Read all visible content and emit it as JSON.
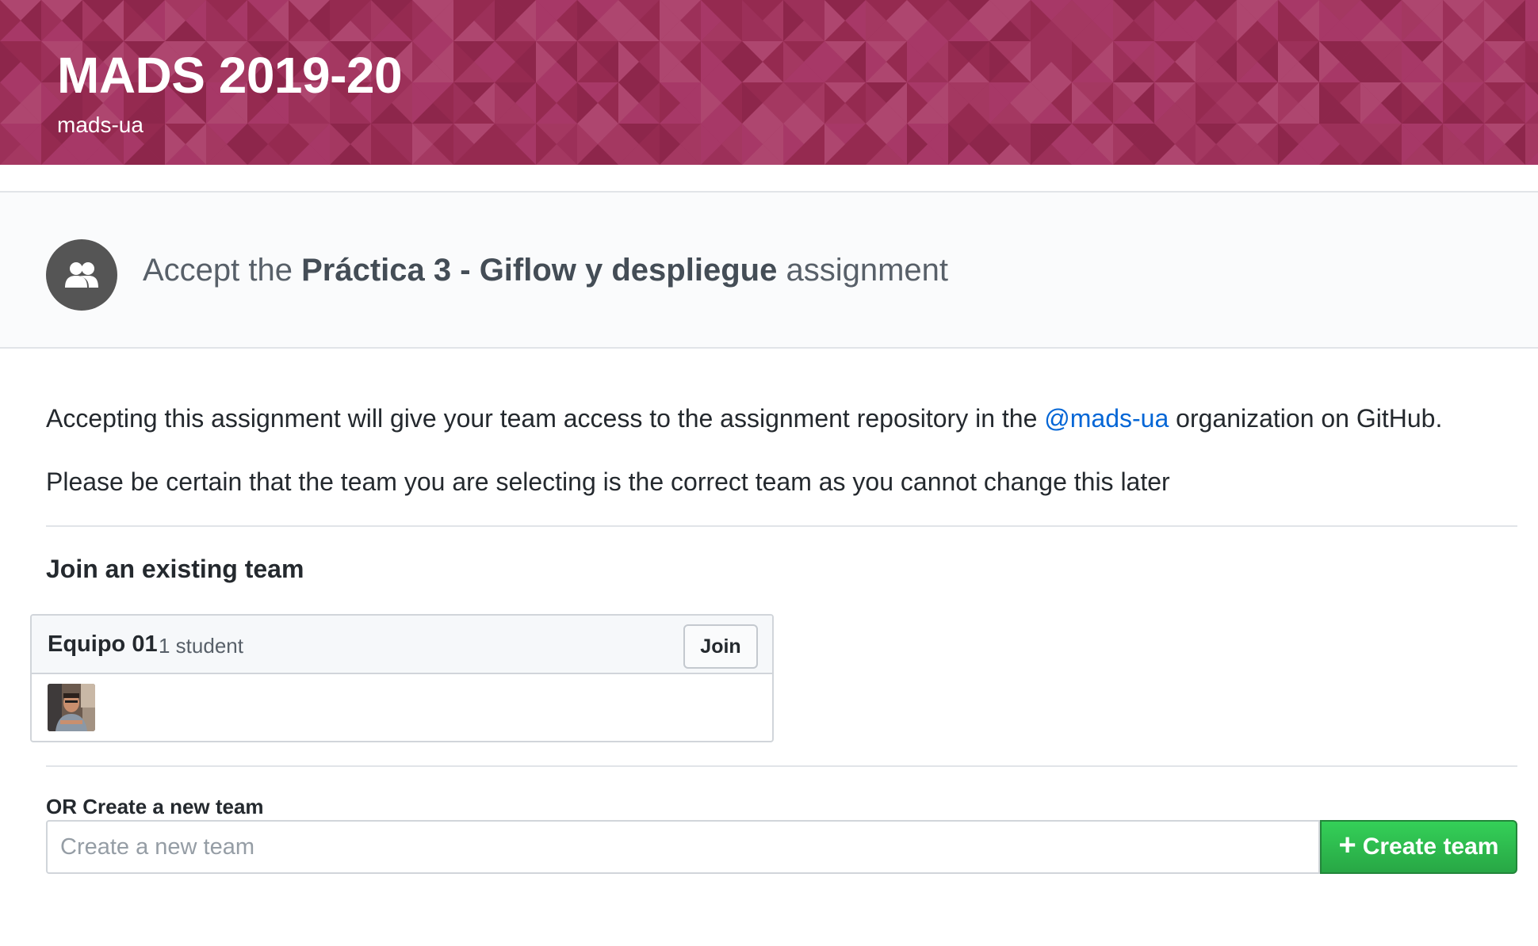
{
  "banner": {
    "title": "MADS 2019-20",
    "subtitle": "mads-ua",
    "color": "#9e325b"
  },
  "assignment": {
    "prefix": "Accept the ",
    "name": "Práctica 3 - Giflow y despliegue",
    "suffix": " assignment",
    "avatar_icon": "people-icon"
  },
  "body": {
    "para1_before": "Accepting this assignment will give your team access to the assignment repository in the ",
    "org_link": "@mads-ua",
    "para1_after": " organization on GitHub.",
    "para2": "Please be certain that the team you are selecting is the correct team as you cannot change this later"
  },
  "join_section": {
    "title": "Join an existing team",
    "teams": [
      {
        "name": "Equipo 01",
        "count": "1 student",
        "join_label": "Join"
      }
    ]
  },
  "create_section": {
    "label": "OR Create a new team",
    "placeholder": "Create a new team",
    "button_label": "Create team",
    "button_icon": "plus-icon",
    "button_color": "#28a745"
  }
}
